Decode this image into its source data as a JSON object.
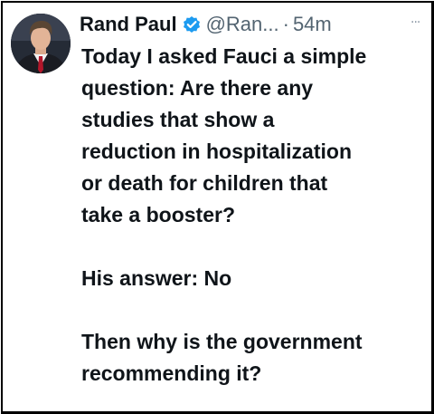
{
  "author": {
    "name": "Rand Paul",
    "handle": "@Ran...",
    "separator": "·",
    "time": "54m",
    "verified": true
  },
  "icons": {
    "verified": "verified-badge-icon",
    "more": "more-options-icon",
    "avatar": "profile-photo"
  },
  "colors": {
    "verified_badge": "#1d9bf0",
    "text_primary": "#0f1419",
    "text_secondary": "#536471"
  },
  "more_glyph": "···",
  "tweet": {
    "lines": [
      "Today I asked Fauci a simple",
      "question: Are there any",
      "studies that show a",
      "reduction in hospitalization",
      "or death for children that",
      "take a booster?"
    ],
    "answer": "His answer: No",
    "closing_lines": [
      "Then why is the government",
      "recommending it?"
    ]
  }
}
